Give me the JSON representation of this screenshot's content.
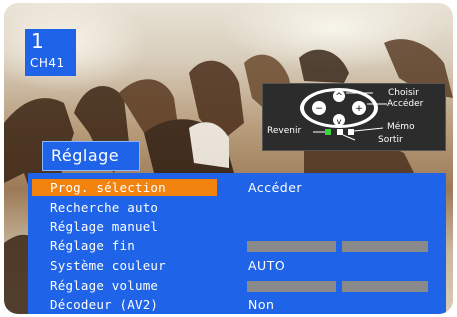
{
  "channel": {
    "number": "1",
    "name": "CH41"
  },
  "remote_legend": {
    "choose": "Choisir",
    "access": "Accéder",
    "back": "Revenir",
    "memo": "Mémo",
    "exit": "Sortir"
  },
  "menu": {
    "title": "Réglage",
    "items": [
      {
        "label": "Prog. sélection",
        "value": "Accéder",
        "selected": true
      },
      {
        "label": "Recherche auto",
        "value": ""
      },
      {
        "label": "Réglage manuel",
        "value": ""
      },
      {
        "label": "Réglage fin",
        "value": ""
      },
      {
        "label": "Système couleur",
        "value": "AUTO"
      },
      {
        "label": "Réglage volume",
        "value": ""
      },
      {
        "label": "Décodeur (AV2)",
        "value": "Non"
      }
    ]
  },
  "colors": {
    "menu_bg": "#1e63e8",
    "selection": "#f2830f",
    "bar": "#8a8a8a"
  }
}
